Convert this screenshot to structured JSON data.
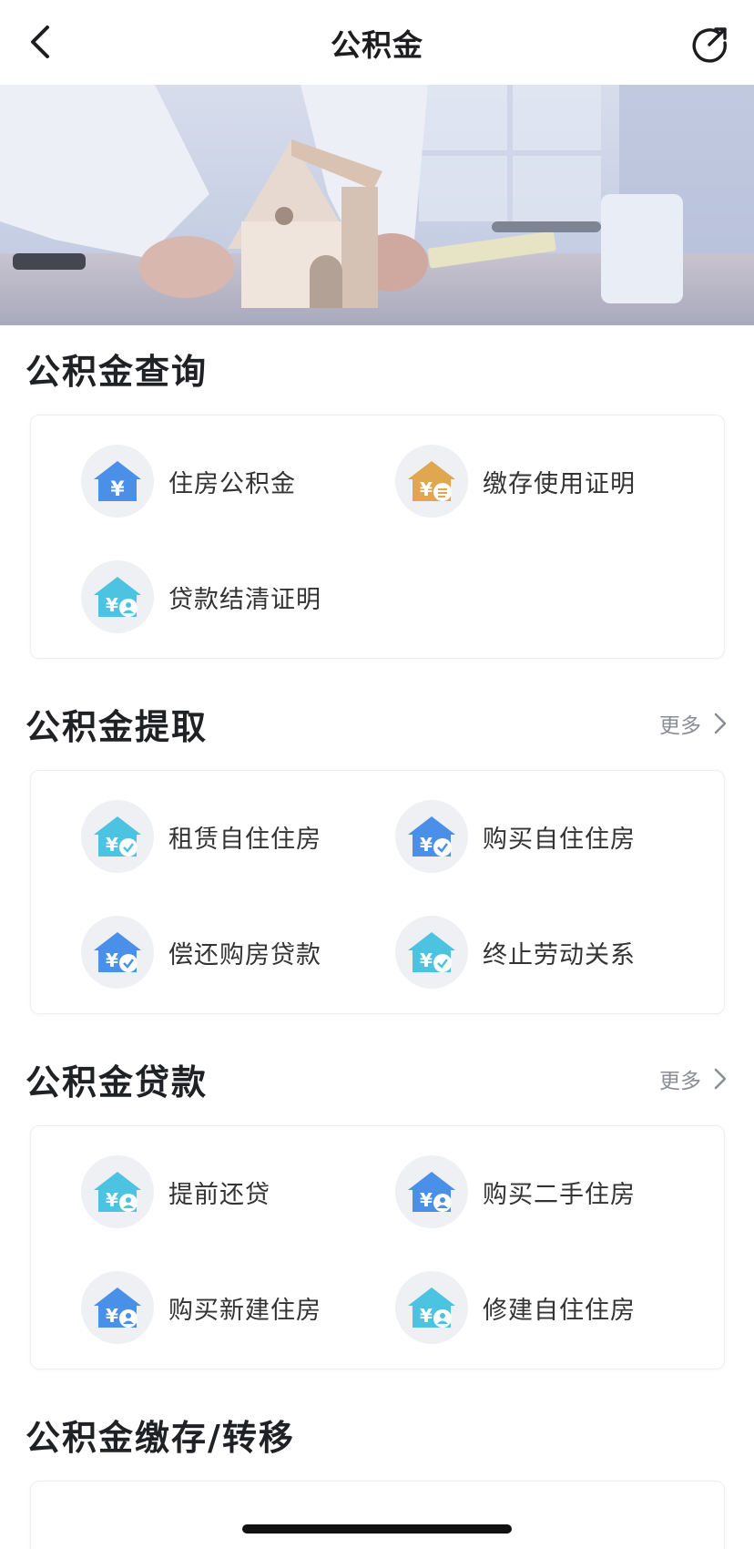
{
  "header": {
    "title": "公积金",
    "back_icon": "chevron-left-icon",
    "share_icon": "share-arrow-icon"
  },
  "banner": {
    "description_icon": "house-model-banner-image"
  },
  "sections": [
    {
      "title": "公积金查询",
      "more": "",
      "items": [
        {
          "label": "住房公积金",
          "icon": "house-yen-icon",
          "color": "#4a8fe8",
          "badge": "none"
        },
        {
          "label": "缴存使用证明",
          "icon": "house-yen-doc-icon",
          "color": "#e0a650",
          "badge": "doc"
        },
        {
          "label": "贷款结清证明",
          "icon": "house-yen-user-icon",
          "color": "#4cc3e0",
          "badge": "user"
        }
      ]
    },
    {
      "title": "公积金提取",
      "more": "更多",
      "items": [
        {
          "label": "租赁自住住房",
          "icon": "house-yen-check-icon",
          "color": "#4cc3e0",
          "badge": "check"
        },
        {
          "label": "购买自住住房",
          "icon": "house-yen-check-icon",
          "color": "#4a8fe8",
          "badge": "check"
        },
        {
          "label": "偿还购房贷款",
          "icon": "house-yen-check-icon",
          "color": "#4a8fe8",
          "badge": "check"
        },
        {
          "label": "终止劳动关系",
          "icon": "house-yen-check-icon",
          "color": "#4cc3e0",
          "badge": "check"
        }
      ]
    },
    {
      "title": "公积金贷款",
      "more": "更多",
      "items": [
        {
          "label": "提前还贷",
          "icon": "house-yen-user-icon",
          "color": "#4cc3e0",
          "badge": "user"
        },
        {
          "label": "购买二手住房",
          "icon": "house-yen-user-icon",
          "color": "#4a8fe8",
          "badge": "user"
        },
        {
          "label": "购买新建住房",
          "icon": "house-yen-user-icon",
          "color": "#4a8fe8",
          "badge": "user"
        },
        {
          "label": "修建自住住房",
          "icon": "house-yen-user-icon",
          "color": "#4cc3e0",
          "badge": "user"
        }
      ]
    },
    {
      "title": "公积金缴存/转移",
      "more": "",
      "items": []
    }
  ]
}
